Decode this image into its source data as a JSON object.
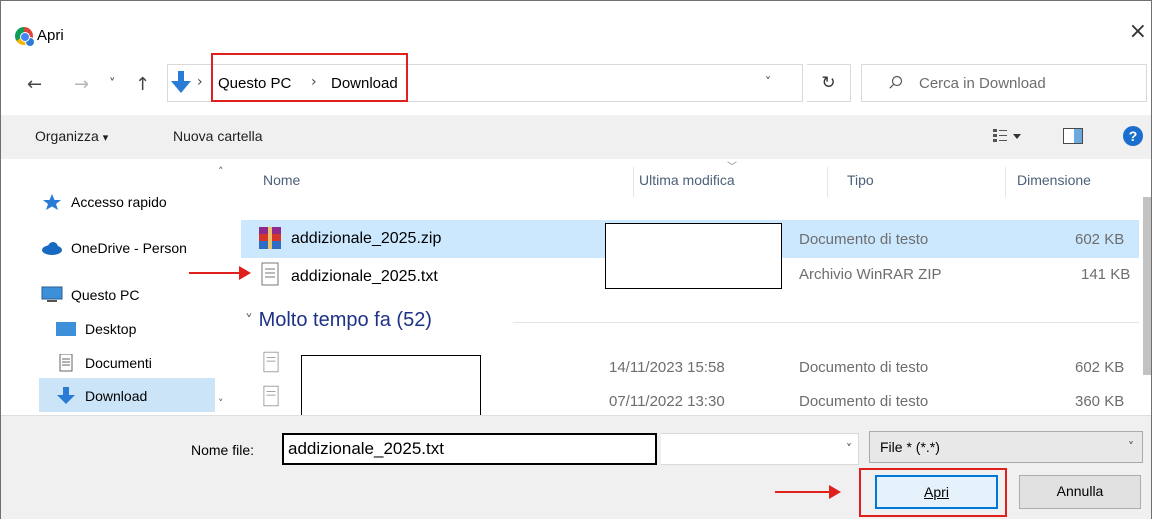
{
  "window": {
    "title": "Apri",
    "close_glyph": "×"
  },
  "nav": {
    "back_glyph": "←",
    "forward_glyph": "→",
    "recent_glyph": "˅",
    "up_glyph": "↑",
    "breadcrumb": [
      "Questo PC",
      "Download"
    ],
    "separator": "›",
    "dropdown_glyph": "˅",
    "refresh_glyph": "↻",
    "search_placeholder": "Cerca in Download"
  },
  "toolbar": {
    "organize_label": "Organizza",
    "organize_caret": "▾",
    "new_folder_label": "Nuova cartella",
    "view_caret": "▾",
    "help_glyph": "?"
  },
  "sidebar": {
    "items": [
      {
        "label": "Accesso rapido",
        "icon": "star-icon"
      },
      {
        "label": "OneDrive - Person",
        "icon": "cloud-icon"
      },
      {
        "label": "Questo PC",
        "icon": "computer-icon"
      },
      {
        "label": "Desktop",
        "icon": "desktop-icon"
      },
      {
        "label": "Documenti",
        "icon": "document-icon"
      },
      {
        "label": "Download",
        "icon": "download-icon",
        "selected": true
      }
    ],
    "scroll_up_glyph": "˄",
    "scroll_down_glyph": "˅"
  },
  "columns": {
    "name": "Nome",
    "modified": "Ultima modifica",
    "type": "Tipo",
    "size": "Dimensione"
  },
  "files": [
    {
      "name": "addizionale_2025.zip",
      "type": "Documento di testo",
      "size": "602 KB",
      "icon": "winrar-icon",
      "selected": true
    },
    {
      "name": "addizionale_2025.txt",
      "type": "Archivio WinRAR ZIP",
      "size": "141 KB",
      "icon": "text-file-icon"
    }
  ],
  "group": {
    "label": "Molto tempo fa (52)",
    "chevron": "˅"
  },
  "old_files": [
    {
      "modified": "14/11/2023 15:58",
      "type": "Documento di testo",
      "size": "602 KB"
    },
    {
      "modified": "07/11/2022 13:30",
      "type": "Documento di testo",
      "size": "360 KB"
    }
  ],
  "bottom": {
    "filename_label": "Nome file:",
    "filename_value": "addizionale_2025.txt",
    "filter_value": "File * (*.*)",
    "open_button": "Apri",
    "cancel_button": "Annulla"
  },
  "colors": {
    "annotation": "#e0201c",
    "selection": "#cce8ff",
    "accent": "#0078d7"
  }
}
